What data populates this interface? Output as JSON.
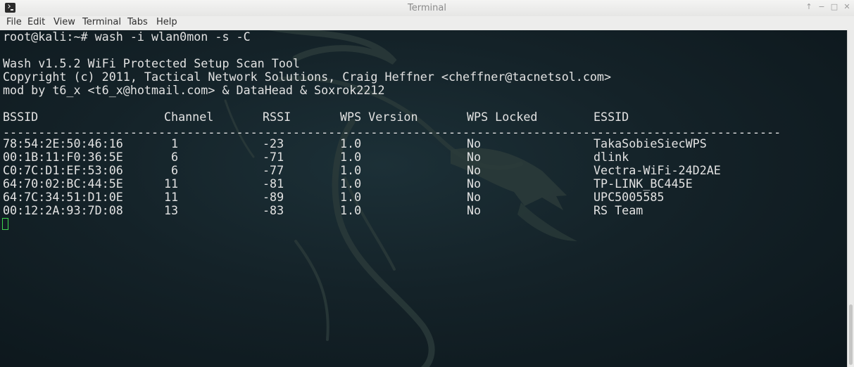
{
  "window": {
    "title": "Terminal",
    "controls": {
      "minimize": "↑",
      "restore": "−",
      "maximize": "□",
      "close": "✕"
    }
  },
  "menu": [
    "File",
    "Edit",
    "View",
    "Terminal",
    "Tabs",
    "Help"
  ],
  "terminal": {
    "prompt": "root@kali:~# wash -i wlan0mon -s -C",
    "header_lines": [
      "Wash v1.5.2 WiFi Protected Setup Scan Tool",
      "Copyright (c) 2011, Tactical Network Solutions, Craig Heffner <cheffner@tacnetsol.com>",
      "mod by t6_x <t6_x@hotmail.com> & DataHead & Soxrok2212"
    ],
    "columns": [
      "BSSID",
      "Channel",
      "RSSI",
      "WPS Version",
      "WPS Locked",
      "ESSID"
    ],
    "separator": "---------------------------------------------------------------------------------------------------------------",
    "rows": [
      [
        "78:54:2E:50:46:16",
        "1",
        "-23",
        "1.0",
        "No",
        "TakaSobieSiecWPS"
      ],
      [
        "00:1B:11:F0:36:5E",
        "6",
        "-71",
        "1.0",
        "No",
        "dlink"
      ],
      [
        "C0:7C:D1:EF:53:06",
        "6",
        "-77",
        "1.0",
        "No",
        "Vectra-WiFi-24D2AE"
      ],
      [
        "64:70:02:BC:44:5E",
        "11",
        "-81",
        "1.0",
        "No",
        "TP-LINK_BC445E"
      ],
      [
        "64:7C:34:51:D1:0E",
        "11",
        "-89",
        "1.0",
        "No",
        "UPC5005585"
      ],
      [
        "00:12:2A:93:7D:08",
        "13",
        "-83",
        "1.0",
        "No",
        "RS Team"
      ]
    ]
  },
  "colors": {
    "background": "#142228",
    "text": "#e2e2e2",
    "cursor": "#3fd64f"
  }
}
